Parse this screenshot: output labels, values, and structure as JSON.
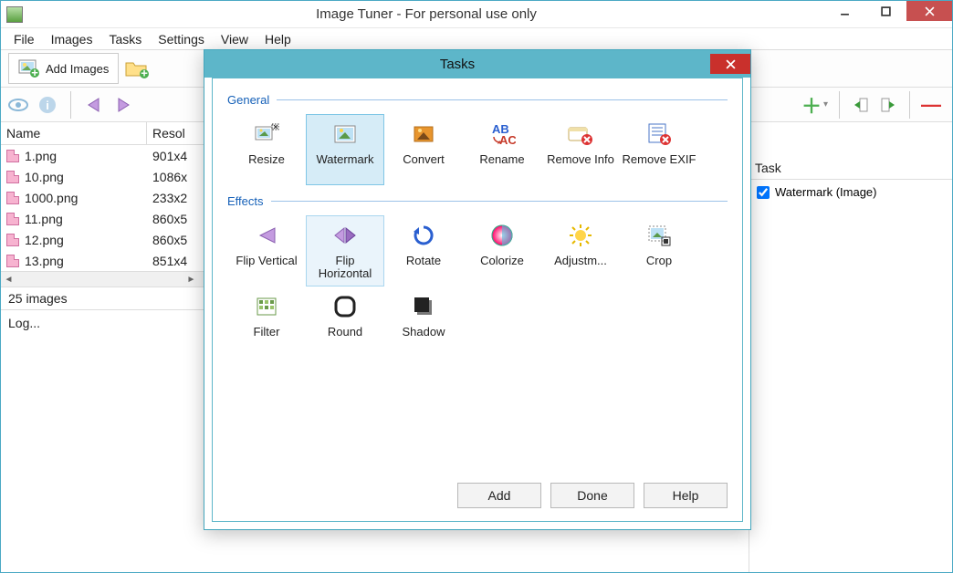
{
  "window": {
    "title": "Image Tuner - For personal use only"
  },
  "menu": {
    "file": "File",
    "images": "Images",
    "tasks": "Tasks",
    "settings": "Settings",
    "view": "View",
    "help": "Help"
  },
  "toolbar": {
    "add_images": "Add Images"
  },
  "list": {
    "col_name": "Name",
    "col_res": "Resol",
    "rows": [
      {
        "name": "1.png",
        "res": "901x4"
      },
      {
        "name": "10.png",
        "res": "1086x"
      },
      {
        "name": "1000.png",
        "res": "233x2"
      },
      {
        "name": "11.png",
        "res": "860x5"
      },
      {
        "name": "12.png",
        "res": "860x5"
      },
      {
        "name": "13.png",
        "res": "851x4"
      }
    ],
    "count_label": "25 images"
  },
  "log_label": "Log...",
  "task_panel": {
    "header": "Task",
    "checked_item": "Watermark (Image)"
  },
  "dialog": {
    "title": "Tasks",
    "group_general": "General",
    "group_effects": "Effects",
    "general_items": [
      "Resize",
      "Watermark",
      "Convert",
      "Rename",
      "Remove Info",
      "Remove EXIF"
    ],
    "effects_items": [
      "Flip Vertical",
      "Flip Horizontal",
      "Rotate",
      "Colorize",
      "Adjustm...",
      "Crop",
      "Filter",
      "Round",
      "Shadow"
    ],
    "selected_general": "Watermark",
    "selected_effect": "Flip Horizontal",
    "btn_add": "Add",
    "btn_done": "Done",
    "btn_help": "Help"
  }
}
